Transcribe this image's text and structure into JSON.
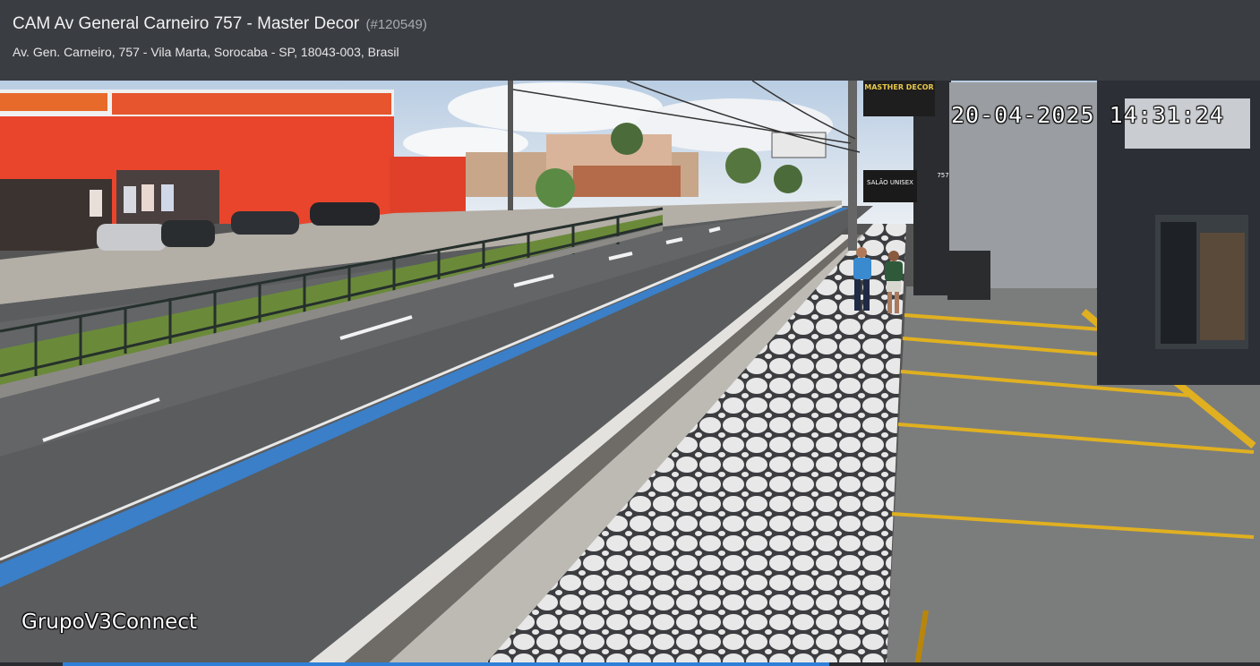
{
  "header": {
    "title": "CAM Av General Carneiro 757 - Master Decor",
    "camera_id": "(#120549)",
    "address": "Av. Gen. Carneiro, 757 - Vila Marta, Sorocaba - SP, 18043-003, Brasil"
  },
  "video": {
    "timestamp": "20-04-2025 14:31:24",
    "watermark": "GrupoV3Connect",
    "signs": {
      "store": "MASTHER DECOR",
      "salon": "SALÃO UNISEX",
      "number": "757"
    },
    "playback_progress": 0.64
  },
  "colors": {
    "header_bg": "#3a3d42",
    "progress": "#2f7fd8",
    "building_orange": "#e8452c",
    "lane_blue": "#3a7fc8",
    "curb_yellow": "#e0b020"
  }
}
